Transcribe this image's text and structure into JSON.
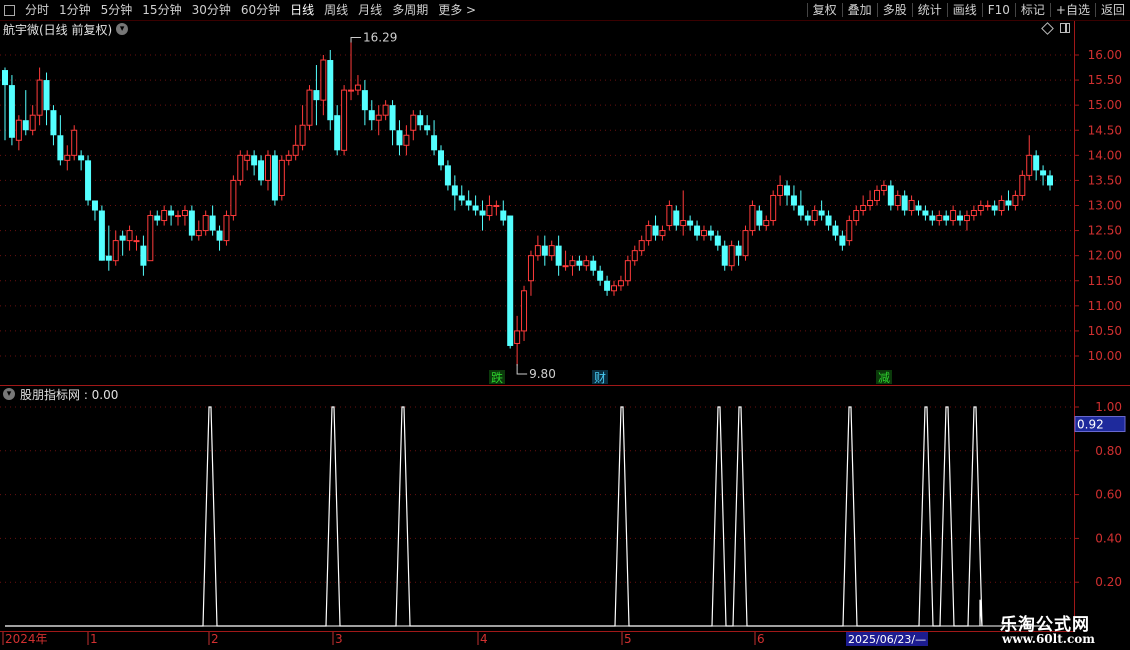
{
  "toolbar": {
    "periods": [
      "分时",
      "1分钟",
      "5分钟",
      "15分钟",
      "30分钟",
      "60分钟",
      "日线",
      "周线",
      "月线",
      "多周期",
      "更多 >"
    ],
    "active_period": "日线",
    "actions": [
      "复权",
      "叠加",
      "多股",
      "统计",
      "画线",
      "F10",
      "标记",
      "+自选",
      "返回"
    ]
  },
  "chart": {
    "title": "航宇微(日线 前复权)",
    "price_axis": [
      "16.00",
      "15.50",
      "15.00",
      "14.50",
      "14.00",
      "13.50",
      "13.00",
      "12.50",
      "12.00",
      "11.50",
      "11.00",
      "10.50",
      "10.00"
    ],
    "high_label": "16.29",
    "low_label": "9.80",
    "markers": [
      {
        "text": "跌",
        "color": "#2dd02d",
        "bg": "#0b3a0b"
      },
      {
        "text": "财",
        "color": "#48c8f0",
        "bg": "#0a2e40"
      },
      {
        "text": "减",
        "color": "#2dd02d",
        "bg": "#0b3a0b"
      }
    ],
    "up_color": "#ff3b3b",
    "down_color": "#54ffff"
  },
  "indicator": {
    "title": "股朋指标网 : 0.00",
    "axis": [
      "1.00",
      "0.80",
      "0.60",
      "0.40",
      "0.20"
    ],
    "current_value": "0.92",
    "current_bg": "#1e2a9c"
  },
  "date_axis": {
    "labels": [
      "2024年",
      "1",
      "2",
      "3",
      "4",
      "5",
      "6"
    ],
    "cursor_date": "2025/06/23/—"
  },
  "watermark": {
    "title": "乐淘公式网",
    "url": "www.60lt.com"
  },
  "chart_data": {
    "type": "candlestick",
    "title": "航宇微(日线 前复权)",
    "ylim": [
      9.6,
      16.5
    ],
    "candles": [
      [
        15.7,
        15.4,
        15.75,
        14.3
      ],
      [
        15.4,
        14.35,
        15.6,
        14.2
      ],
      [
        14.3,
        14.7,
        14.8,
        14.1
      ],
      [
        14.7,
        14.5,
        15.3,
        14.4
      ],
      [
        14.5,
        14.8,
        15.0,
        14.4
      ],
      [
        14.8,
        15.5,
        15.75,
        14.6
      ],
      [
        15.5,
        14.9,
        15.65,
        14.6
      ],
      [
        14.9,
        14.4,
        15.0,
        14.2
      ],
      [
        14.4,
        13.9,
        14.8,
        13.8
      ],
      [
        13.9,
        14.0,
        14.2,
        13.7
      ],
      [
        14.0,
        14.5,
        14.6,
        13.9
      ],
      [
        14.0,
        13.9,
        14.1,
        13.7
      ],
      [
        13.9,
        13.1,
        14.0,
        13.0
      ],
      [
        13.1,
        12.9,
        13.1,
        12.7
      ],
      [
        12.9,
        11.9,
        13.0,
        11.9
      ],
      [
        12.0,
        11.9,
        12.6,
        11.7
      ],
      [
        11.9,
        12.3,
        12.5,
        11.8
      ],
      [
        12.4,
        12.3,
        12.5,
        12.0
      ],
      [
        12.3,
        12.5,
        12.6,
        12.1
      ],
      [
        12.3,
        12.3,
        12.4,
        12.1
      ],
      [
        12.2,
        11.8,
        12.4,
        11.6
      ],
      [
        11.9,
        12.8,
        12.9,
        11.9
      ],
      [
        12.8,
        12.7,
        12.9,
        12.6
      ],
      [
        12.7,
        12.9,
        13.0,
        12.6
      ],
      [
        12.9,
        12.8,
        13.0,
        12.6
      ],
      [
        12.8,
        12.8,
        12.9,
        12.6
      ],
      [
        12.8,
        12.9,
        13.0,
        12.6
      ],
      [
        12.9,
        12.4,
        13.0,
        12.3
      ],
      [
        12.4,
        12.5,
        12.7,
        12.3
      ],
      [
        12.5,
        12.8,
        12.9,
        12.4
      ],
      [
        12.8,
        12.5,
        13.0,
        12.4
      ],
      [
        12.5,
        12.3,
        12.6,
        12.1
      ],
      [
        12.3,
        12.8,
        12.9,
        12.2
      ],
      [
        12.8,
        13.5,
        13.6,
        12.7
      ],
      [
        13.5,
        14.0,
        14.1,
        13.4
      ],
      [
        13.9,
        14.0,
        14.1,
        13.7
      ],
      [
        14.0,
        13.8,
        14.1,
        13.6
      ],
      [
        13.9,
        13.5,
        14.0,
        13.4
      ],
      [
        13.5,
        14.0,
        14.1,
        13.3
      ],
      [
        14.0,
        13.1,
        14.1,
        13.0
      ],
      [
        13.2,
        13.9,
        14.0,
        13.1
      ],
      [
        13.9,
        14.0,
        14.1,
        13.8
      ],
      [
        14.0,
        14.2,
        14.6,
        13.9
      ],
      [
        14.2,
        14.6,
        15.0,
        14.1
      ],
      [
        14.6,
        15.3,
        15.4,
        14.5
      ],
      [
        15.3,
        15.1,
        15.8,
        14.6
      ],
      [
        15.1,
        15.9,
        16.0,
        14.8
      ],
      [
        15.9,
        14.7,
        16.1,
        14.5
      ],
      [
        14.8,
        14.1,
        15.0,
        14.0
      ],
      [
        14.1,
        15.3,
        15.4,
        14.0
      ],
      [
        15.3,
        15.3,
        16.29,
        15.1
      ],
      [
        15.3,
        15.4,
        15.6,
        15.2
      ],
      [
        15.3,
        14.9,
        15.5,
        14.6
      ],
      [
        14.9,
        14.7,
        15.1,
        14.5
      ],
      [
        14.7,
        14.8,
        15.0,
        14.4
      ],
      [
        14.8,
        15.0,
        15.1,
        14.7
      ],
      [
        15.0,
        14.5,
        15.1,
        14.2
      ],
      [
        14.5,
        14.2,
        14.7,
        14.0
      ],
      [
        14.2,
        14.4,
        14.6,
        14.0
      ],
      [
        14.5,
        14.8,
        14.9,
        14.3
      ],
      [
        14.8,
        14.6,
        14.9,
        14.5
      ],
      [
        14.6,
        14.5,
        14.8,
        14.4
      ],
      [
        14.4,
        14.1,
        14.7,
        14.0
      ],
      [
        14.1,
        13.8,
        14.2,
        13.7
      ],
      [
        13.8,
        13.4,
        13.9,
        13.3
      ],
      [
        13.4,
        13.2,
        13.6,
        12.9
      ],
      [
        13.2,
        13.1,
        13.4,
        13.0
      ],
      [
        13.1,
        13.0,
        13.3,
        12.9
      ],
      [
        13.0,
        12.9,
        13.2,
        12.8
      ],
      [
        12.9,
        12.8,
        13.1,
        12.5
      ],
      [
        12.8,
        13.0,
        13.2,
        12.7
      ],
      [
        13.0,
        13.0,
        13.1,
        12.8
      ],
      [
        12.9,
        12.7,
        13.1,
        12.6
      ],
      [
        12.8,
        10.2,
        12.8,
        10.15
      ],
      [
        10.25,
        10.5,
        10.8,
        9.8
      ],
      [
        10.5,
        11.3,
        11.4,
        10.3
      ],
      [
        11.5,
        12.0,
        12.1,
        11.2
      ],
      [
        12.0,
        12.2,
        12.4,
        11.9
      ],
      [
        12.2,
        12.0,
        12.4,
        11.8
      ],
      [
        12.0,
        12.2,
        12.3,
        11.9
      ],
      [
        12.2,
        11.8,
        12.4,
        11.6
      ],
      [
        11.8,
        11.8,
        12.1,
        11.7
      ],
      [
        11.8,
        11.9,
        12.0,
        11.6
      ],
      [
        11.9,
        11.8,
        12.0,
        11.7
      ],
      [
        11.8,
        11.9,
        12.0,
        11.7
      ],
      [
        11.9,
        11.7,
        12.0,
        11.6
      ],
      [
        11.7,
        11.5,
        11.8,
        11.4
      ],
      [
        11.5,
        11.3,
        11.6,
        11.2
      ],
      [
        11.3,
        11.4,
        11.5,
        11.2
      ],
      [
        11.4,
        11.5,
        11.6,
        11.3
      ],
      [
        11.5,
        11.9,
        12.0,
        11.4
      ],
      [
        11.9,
        12.1,
        12.2,
        11.8
      ],
      [
        12.1,
        12.3,
        12.4,
        12.0
      ],
      [
        12.3,
        12.6,
        12.7,
        12.2
      ],
      [
        12.6,
        12.4,
        12.8,
        12.3
      ],
      [
        12.4,
        12.5,
        12.6,
        12.3
      ],
      [
        12.6,
        13.0,
        13.1,
        12.5
      ],
      [
        12.9,
        12.6,
        13.0,
        12.5
      ],
      [
        12.6,
        12.7,
        13.3,
        12.4
      ],
      [
        12.7,
        12.6,
        12.8,
        12.5
      ],
      [
        12.6,
        12.4,
        12.7,
        12.3
      ],
      [
        12.4,
        12.5,
        12.6,
        12.3
      ],
      [
        12.5,
        12.4,
        12.6,
        12.3
      ],
      [
        12.4,
        12.2,
        12.5,
        12.1
      ],
      [
        12.2,
        11.8,
        12.3,
        11.7
      ],
      [
        11.8,
        12.2,
        12.3,
        11.7
      ],
      [
        12.2,
        12.0,
        12.3,
        11.8
      ],
      [
        12.0,
        12.5,
        12.6,
        11.9
      ],
      [
        12.5,
        13.0,
        13.1,
        12.4
      ],
      [
        12.9,
        12.6,
        13.0,
        12.5
      ],
      [
        12.6,
        12.7,
        12.8,
        12.5
      ],
      [
        12.7,
        13.2,
        13.3,
        12.6
      ],
      [
        13.2,
        13.4,
        13.6,
        13.0
      ],
      [
        13.4,
        13.2,
        13.5,
        13.0
      ],
      [
        13.2,
        13.0,
        13.4,
        12.9
      ],
      [
        13.0,
        12.8,
        13.3,
        12.7
      ],
      [
        12.8,
        12.7,
        12.9,
        12.6
      ],
      [
        12.7,
        12.9,
        13.0,
        12.6
      ],
      [
        12.9,
        12.8,
        13.1,
        12.7
      ],
      [
        12.8,
        12.6,
        12.9,
        12.5
      ],
      [
        12.6,
        12.4,
        12.7,
        12.3
      ],
      [
        12.4,
        12.2,
        12.5,
        12.1
      ],
      [
        12.3,
        12.7,
        12.8,
        12.2
      ],
      [
        12.7,
        12.9,
        13.0,
        12.6
      ],
      [
        12.9,
        13.0,
        13.2,
        12.8
      ],
      [
        13.0,
        13.1,
        13.3,
        12.9
      ],
      [
        13.1,
        13.3,
        13.4,
        13.0
      ],
      [
        13.3,
        13.4,
        13.5,
        13.2
      ],
      [
        13.4,
        13.0,
        13.5,
        12.9
      ],
      [
        13.0,
        13.2,
        13.3,
        12.9
      ],
      [
        13.2,
        12.9,
        13.3,
        12.8
      ],
      [
        12.9,
        13.1,
        13.2,
        12.8
      ],
      [
        13.0,
        12.9,
        13.1,
        12.8
      ],
      [
        12.9,
        12.8,
        13.0,
        12.7
      ],
      [
        12.8,
        12.7,
        12.9,
        12.6
      ],
      [
        12.7,
        12.8,
        12.9,
        12.6
      ],
      [
        12.8,
        12.7,
        12.9,
        12.6
      ],
      [
        12.7,
        12.9,
        13.0,
        12.6
      ],
      [
        12.8,
        12.7,
        12.9,
        12.6
      ],
      [
        12.7,
        12.8,
        12.9,
        12.5
      ],
      [
        12.8,
        12.9,
        13.0,
        12.7
      ],
      [
        12.9,
        13.0,
        13.1,
        12.8
      ],
      [
        13.0,
        13.0,
        13.1,
        12.9
      ],
      [
        13.0,
        12.9,
        13.1,
        12.8
      ],
      [
        12.9,
        13.1,
        13.2,
        12.8
      ],
      [
        13.1,
        13.0,
        13.3,
        12.9
      ],
      [
        13.0,
        13.2,
        13.3,
        12.9
      ],
      [
        13.2,
        13.6,
        13.7,
        13.1
      ],
      [
        13.6,
        14.0,
        14.4,
        13.5
      ],
      [
        14.0,
        13.7,
        14.1,
        13.5
      ],
      [
        13.7,
        13.6,
        13.8,
        13.4
      ],
      [
        13.6,
        13.4,
        13.7,
        13.3
      ]
    ],
    "indicator": {
      "title": "股朋指标网",
      "ylim": [
        0,
        1
      ],
      "signals": [
        1,
        1,
        1,
        1,
        1,
        1,
        1,
        1,
        1,
        1
      ],
      "last_value": 0.92
    }
  }
}
